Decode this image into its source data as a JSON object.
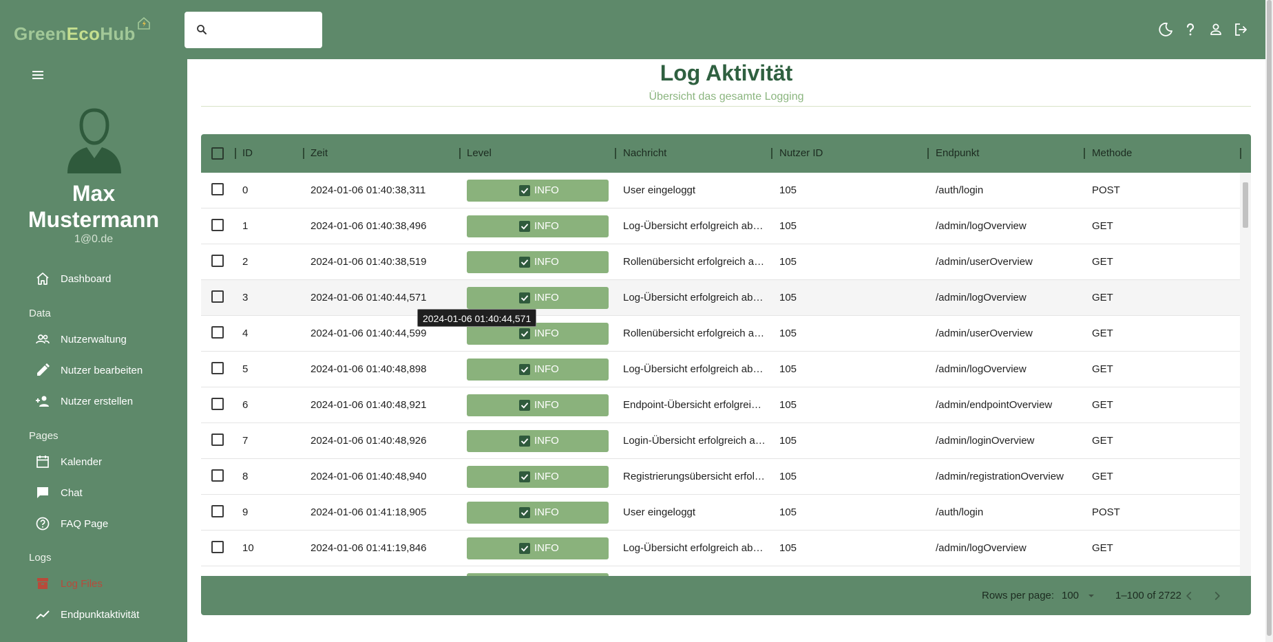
{
  "app": {
    "logo": {
      "part1": "Green",
      "part2": "Eco",
      "part3": "Hub"
    },
    "search": {
      "placeholder": ""
    }
  },
  "user": {
    "first_name": "Max",
    "last_name": "Mustermann",
    "email": "1@0.de"
  },
  "sidebar": {
    "dashboard": "Dashboard",
    "section_data": "Data",
    "nutzerwaltung": "Nutzerwaltung",
    "nutzer_bearbeiten": "Nutzer bearbeiten",
    "nutzer_erstellen": "Nutzer erstellen",
    "section_pages": "Pages",
    "kalender": "Kalender",
    "chat": "Chat",
    "faq": "FAQ Page",
    "section_logs": "Logs",
    "log_files": "Log Files",
    "endpunkt": "Endpunktaktivität"
  },
  "page": {
    "title": "Log Aktivität",
    "subtitle": "Übersicht das gesamte Logging"
  },
  "table": {
    "headers": {
      "id": "ID",
      "zeit": "Zeit",
      "level": "Level",
      "nachricht": "Nachricht",
      "nutzer_id": "Nutzer ID",
      "endpunkt": "Endpunkt",
      "methode": "Methode"
    },
    "rows": [
      {
        "id": "0",
        "zeit": "2024-01-06 01:40:38,311",
        "level": "INFO",
        "nachricht": "User eingeloggt",
        "nutzer": "105",
        "endpunkt": "/auth/login",
        "methode": "POST"
      },
      {
        "id": "1",
        "zeit": "2024-01-06 01:40:38,496",
        "level": "INFO",
        "nachricht": "Log-Übersicht erfolgreich abg…",
        "nutzer": "105",
        "endpunkt": "/admin/logOverview",
        "methode": "GET"
      },
      {
        "id": "2",
        "zeit": "2024-01-06 01:40:38,519",
        "level": "INFO",
        "nachricht": "Rollenübersicht erfolgreich ab…",
        "nutzer": "105",
        "endpunkt": "/admin/userOverview",
        "methode": "GET"
      },
      {
        "id": "3",
        "zeit": "2024-01-06 01:40:44,571",
        "level": "INFO",
        "nachricht": "Log-Übersicht erfolgreich abg…",
        "nutzer": "105",
        "endpunkt": "/admin/logOverview",
        "methode": "GET"
      },
      {
        "id": "4",
        "zeit": "2024-01-06 01:40:44,599",
        "level": "INFO",
        "nachricht": "Rollenübersicht erfolgreich ab…",
        "nutzer": "105",
        "endpunkt": "/admin/userOverview",
        "methode": "GET"
      },
      {
        "id": "5",
        "zeit": "2024-01-06 01:40:48,898",
        "level": "INFO",
        "nachricht": "Log-Übersicht erfolgreich abg…",
        "nutzer": "105",
        "endpunkt": "/admin/logOverview",
        "methode": "GET"
      },
      {
        "id": "6",
        "zeit": "2024-01-06 01:40:48,921",
        "level": "INFO",
        "nachricht": "Endpoint-Übersicht erfolgreic…",
        "nutzer": "105",
        "endpunkt": "/admin/endpointOverview",
        "methode": "GET"
      },
      {
        "id": "7",
        "zeit": "2024-01-06 01:40:48,926",
        "level": "INFO",
        "nachricht": "Login-Übersicht erfolgreich ab…",
        "nutzer": "105",
        "endpunkt": "/admin/loginOverview",
        "methode": "GET"
      },
      {
        "id": "8",
        "zeit": "2024-01-06 01:40:48,940",
        "level": "INFO",
        "nachricht": "Registrierungsübersicht erfolg…",
        "nutzer": "105",
        "endpunkt": "/admin/registrationOverview",
        "methode": "GET"
      },
      {
        "id": "9",
        "zeit": "2024-01-06 01:41:18,905",
        "level": "INFO",
        "nachricht": "User eingeloggt",
        "nutzer": "105",
        "endpunkt": "/auth/login",
        "methode": "POST"
      },
      {
        "id": "10",
        "zeit": "2024-01-06 01:41:19,846",
        "level": "INFO",
        "nachricht": "Log-Übersicht erfolgreich abg…",
        "nutzer": "105",
        "endpunkt": "/admin/logOverview",
        "methode": "GET"
      },
      {
        "id": "",
        "zeit": "",
        "level": "",
        "nachricht": "",
        "nutzer": "",
        "endpunkt": "",
        "methode": ""
      }
    ],
    "footer": {
      "rows_per_page_label": "Rows per page:",
      "rows_per_page_value": "100",
      "range": "1–100 of 2722"
    },
    "tooltip": "2024-01-06 01:40:44,571"
  },
  "icons": {
    "search": "search-icon",
    "dark_mode": "moon-icon",
    "help": "help-icon",
    "profile": "person-icon",
    "logout": "logout-icon",
    "menu": "menu-icon",
    "avatar": "avatar-icon"
  },
  "colors": {
    "primary": "#5e896a",
    "level_badge": "#8ab27c",
    "title": "#2f6040",
    "subtitle": "#8bb57f",
    "active_nav": "#b84a3a"
  }
}
